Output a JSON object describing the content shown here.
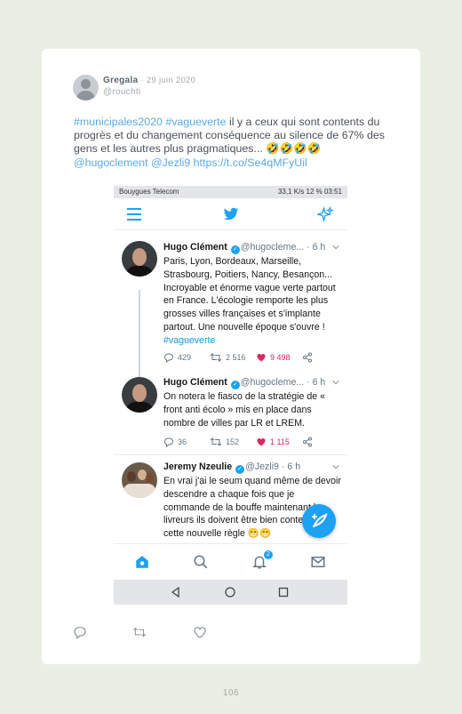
{
  "post": {
    "author_name": "Gregala",
    "date": "29 juin 2020",
    "handle": "@rouchti",
    "text_parts": {
      "hashtags": "#municipales2020 #vagueverte",
      "body": " il y a ceux qui sont contents du progrès et du changement conséquence au silence de 67% des gens et les autres plus pragmatiques... 🤣🤣🤣🤣",
      "mentions": "@hugoclement @Jezli9 https://t.co/Se4qMFyUil"
    }
  },
  "phone": {
    "status_left": "Bouygues Telecom",
    "status_right": "33,1 K/s  12 %  03:51",
    "tweets": [
      {
        "name": "Hugo Clément",
        "handle_time": "@hugocleme... · 6 h",
        "text": "Paris, Lyon, Bordeaux, Marseille, Strasbourg, Poitiers, Nancy, Besançon... Incroyable et énorme vague verte partout en France. L'écologie remporte les plus grosses villes françaises et s'implante partout. Une nouvelle époque s'ouvre ! ",
        "hashtag": "#vagueverte",
        "replies": "429",
        "retweets": "2 516",
        "likes": "9 498"
      },
      {
        "name": "Hugo Clément",
        "handle_time": "@hugocleme... · 6 h",
        "text": "On notera le fiasco de la stratégie de « front anti écolo » mis en place dans nombre de villes par LR et LREM.",
        "replies": "36",
        "retweets": "152",
        "likes": "1 115"
      },
      {
        "name": "Jeremy Nzeulie",
        "handle_time": "@Jezli9 · 6 h",
        "text": "En vrai j'ai le seum quand même de devoir descendre a chaque fois que je commande de la bouffe maintenant les livreurs ils doivent être bien content de cette nouvelle règle 😁😁"
      }
    ],
    "notification_count": "2"
  },
  "page_number": "106",
  "colors": {
    "background": "#e9efe2",
    "link_blue": "#5aa9e6",
    "twitter_blue": "#1da1f2",
    "like_red": "#e0245e"
  }
}
